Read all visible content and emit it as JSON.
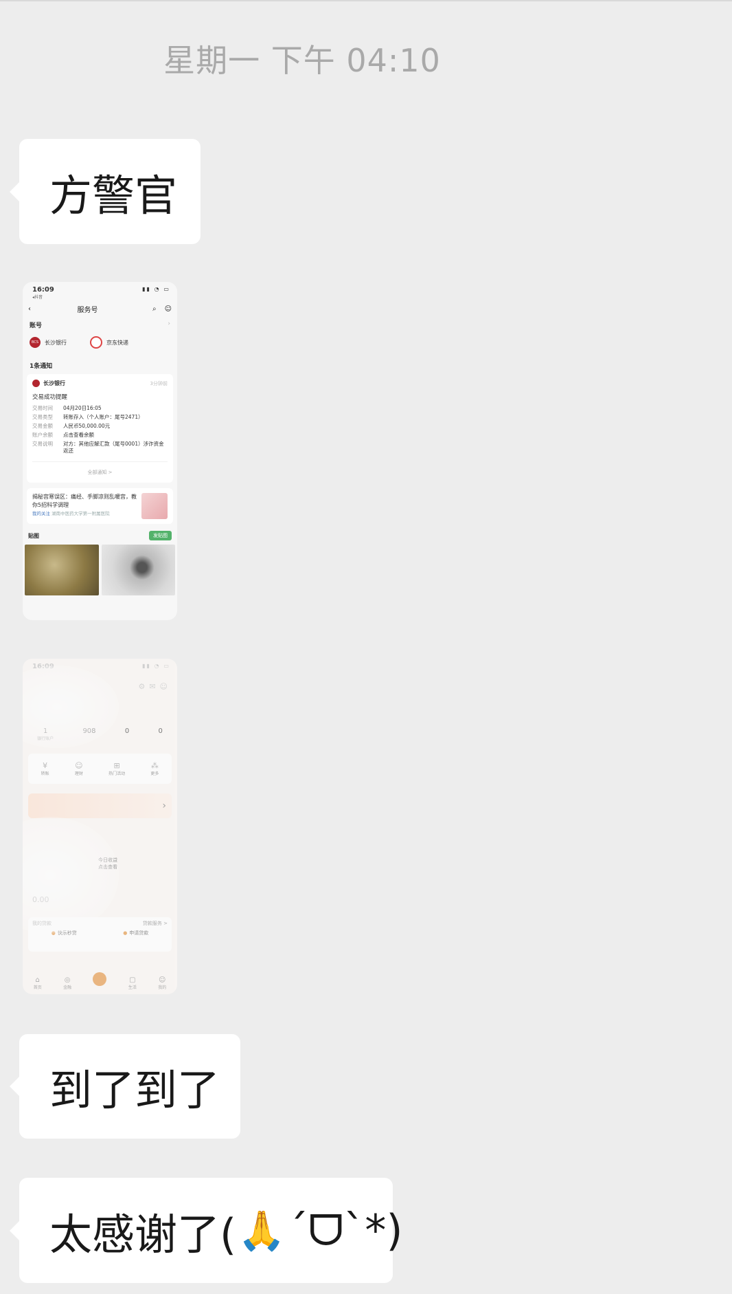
{
  "timestamp": "星期一 下午 04:10",
  "messages": [
    {
      "type": "text",
      "text": "方警官"
    },
    {
      "type": "image",
      "name": "bank-notification-screenshot"
    },
    {
      "type": "image",
      "name": "bank-app-screenshot"
    },
    {
      "type": "text",
      "text": "到了到了"
    },
    {
      "type": "text",
      "text_before": "太感谢了(",
      "emoji": "🙏",
      "text_after": "´ᗜ`*)"
    }
  ],
  "shot1": {
    "status_time": "16:09",
    "status_sub": "◂抖音",
    "status_icons": "▮▮ ◔ ▭",
    "nav_title": "服务号",
    "accounts_label": "账号",
    "accounts": [
      {
        "name": "长沙银行",
        "logo": "BCS"
      },
      {
        "name": "京东快递",
        "logo": ""
      }
    ],
    "notice_label": "1条通知",
    "card": {
      "source": "长沙银行",
      "time": "3分钟前",
      "title": "交易成功提醒",
      "rows": [
        {
          "k": "交易时间",
          "v": "04月20日16:05"
        },
        {
          "k": "交易类型",
          "v": "转账存入（个人账户：尾号2471）"
        },
        {
          "k": "交易金额",
          "v": "人民币50,000.00元"
        },
        {
          "k": "账户余额",
          "v": "点击查看余额"
        },
        {
          "k": "交易说明",
          "v": "对方：其他应解汇款（尾号0001）涉诈资金返还"
        }
      ],
      "more": "全部通知 >"
    },
    "article": {
      "title": "揭秘宫寒误区：痛经、手脚凉则乱暖宫，教你5招科学调理",
      "meta_link": "我的关注",
      "meta_text": "湖南中医药大学第一附属医院"
    },
    "pics_label": "贴图",
    "pics_button": "发贴图"
  },
  "shot2": {
    "status_time": "16:09",
    "stats": [
      {
        "value": "1",
        "label": "银行账户"
      },
      {
        "value": "908",
        "label": ""
      },
      {
        "value": "0",
        "label": ""
      },
      {
        "value": "0",
        "label": ""
      }
    ],
    "quick": [
      {
        "icon": "¥",
        "label": "转账"
      },
      {
        "icon": "☺",
        "label": "理财"
      },
      {
        "icon": "⊞",
        "label": "热门活动"
      },
      {
        "icon": "⁂",
        "label": "更多"
      }
    ],
    "banner_arrow": "›",
    "info_line1": "今日收益",
    "info_line2": "点击查看",
    "balance": "0.00",
    "loans_label": "我的贷款",
    "loans_more": "贷款服务 >",
    "loan_items": [
      "快乐秒贷",
      "申请贷款"
    ],
    "tabs": [
      "首页",
      "金融",
      "",
      "生活",
      "我的"
    ]
  }
}
